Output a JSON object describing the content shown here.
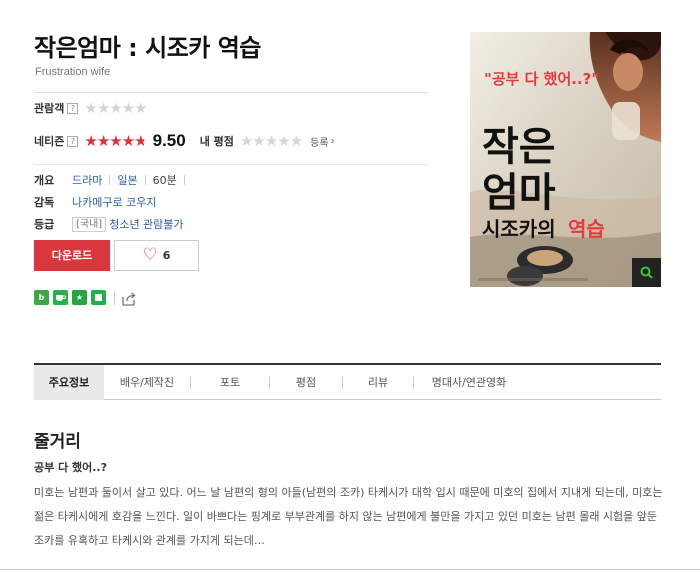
{
  "movie": {
    "title": "작은엄마 : 시조카 역습",
    "original_title": "Frustration wife"
  },
  "ratings": {
    "audience_label": "관람객",
    "audience_help": "?",
    "audience_stars_fraction": 0,
    "netizen_label": "네티즌",
    "netizen_help": "?",
    "netizen_stars_fraction": 0.95,
    "netizen_score": "9.50",
    "my_rating_label": "내 평점",
    "my_stars_fraction": 0,
    "register_label": "등록",
    "star_color": "#e3303f"
  },
  "info": {
    "overview_label": "개요",
    "genre": "드라마",
    "country": "일본",
    "runtime": "60분",
    "director_label": "감독",
    "director": "나카메구로 코우지",
    "rating_label": "등급",
    "rating_region": "[국내]",
    "rating_value": "청소년 관람불가"
  },
  "actions": {
    "download_label": "다운로드",
    "like_count": "6",
    "accent_color": "#d9363e"
  },
  "share_icons": [
    "blog-icon",
    "cafe-icon",
    "star-share-icon",
    "bookmark-icon",
    "export-icon"
  ],
  "poster": {
    "tagline": "\"공부 다 했어..?\"",
    "title_line1": "작은",
    "title_line2": "엄마",
    "subtitle": "시조카의",
    "subtitle_emph": "역습"
  },
  "tabs": [
    {
      "label": "주요정보",
      "active": true
    },
    {
      "label": "배우/제작진",
      "active": false
    },
    {
      "label": "포토",
      "active": false
    },
    {
      "label": "평점",
      "active": false
    },
    {
      "label": "리뷰",
      "active": false
    },
    {
      "label": "명대사/연관영화",
      "active": false
    }
  ],
  "synopsis": {
    "section_title": "줄거리",
    "headline": "공부 다 했어..?",
    "body": "미호는 남편과 둘이서 살고 있다. 어느 날 남편의 형의 아들(남편의 조카) 타케시가 대학 입시 때문에 미호의 집에서 지내게 되는데, 미호는 젊은 타케시에게 호감을 느낀다. 일이 바쁘다는 핑계로 부부관계를 하지 않는 남편에게 불만을 가지고 있던 미호는 남편 몰래 시험을 앞둔 조카를 유혹하고 타케시와 관계를 가지게 되는데…"
  }
}
